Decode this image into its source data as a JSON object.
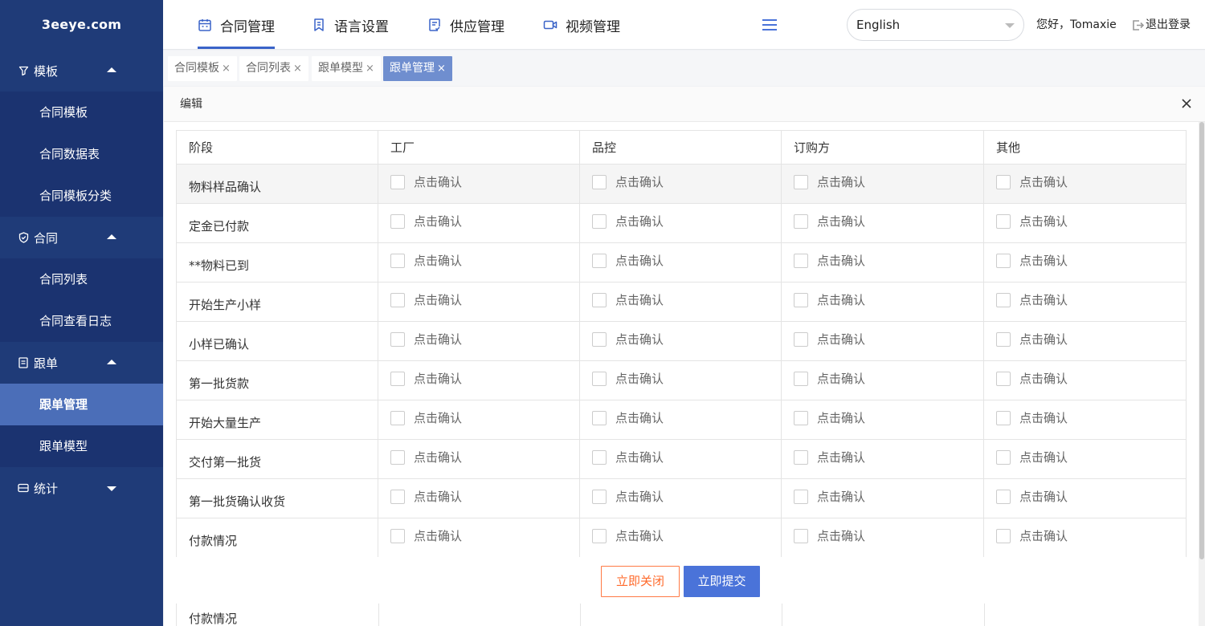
{
  "brand": "3eeye.com",
  "sidebar": {
    "groups": [
      {
        "label": "模板",
        "icon": "filter-icon",
        "expanded": true,
        "items": [
          "合同模板",
          "合同数据表",
          "合同模板分类"
        ]
      },
      {
        "label": "合同",
        "icon": "shield-check-icon",
        "expanded": true,
        "items": [
          "合同列表",
          "合同查看日志"
        ]
      },
      {
        "label": "跟单",
        "icon": "document-icon",
        "expanded": true,
        "items": [
          "跟单管理",
          "跟单模型"
        ],
        "active_item": "跟单管理"
      },
      {
        "label": "统计",
        "icon": "ticket-icon",
        "expanded": false,
        "items": []
      }
    ]
  },
  "header": {
    "nav": [
      {
        "label": "合同管理",
        "icon": "calendar-icon",
        "active": true
      },
      {
        "label": "语言设置",
        "icon": "bookmark-icon",
        "active": false
      },
      {
        "label": "供应管理",
        "icon": "checklist-icon",
        "active": false
      },
      {
        "label": "视频管理",
        "icon": "video-icon",
        "active": false
      }
    ],
    "language": "English",
    "greeting": "您好，Tomaxie",
    "logout": "退出登录"
  },
  "tabs": [
    {
      "label": "合同模板",
      "active": false
    },
    {
      "label": "合同列表",
      "active": false
    },
    {
      "label": "跟单模型",
      "active": false
    },
    {
      "label": "跟单管理",
      "active": true
    }
  ],
  "modal": {
    "title": "编辑",
    "columns": [
      "阶段",
      "工厂",
      "品控",
      "订购方",
      "其他"
    ],
    "checkbox_label": "点击确认",
    "rows": [
      "物料样品确认",
      "定金已付款",
      "**物料已到",
      "开始生产小样",
      "小样已确认",
      "第一批货款",
      "开始大量生产",
      "交付第一批货",
      "第一批货确认收货",
      "付款情况"
    ],
    "ghost_row": "付款情况",
    "close_button": "立即关闭",
    "submit_button": "立即提交"
  },
  "colors": {
    "sidebar": "#1f3b78",
    "sidebar_submenu": "#1b3370",
    "sidebar_active": "#4b6eb8",
    "accent": "#4a73d9",
    "close_btn": "#ff6a2b"
  }
}
